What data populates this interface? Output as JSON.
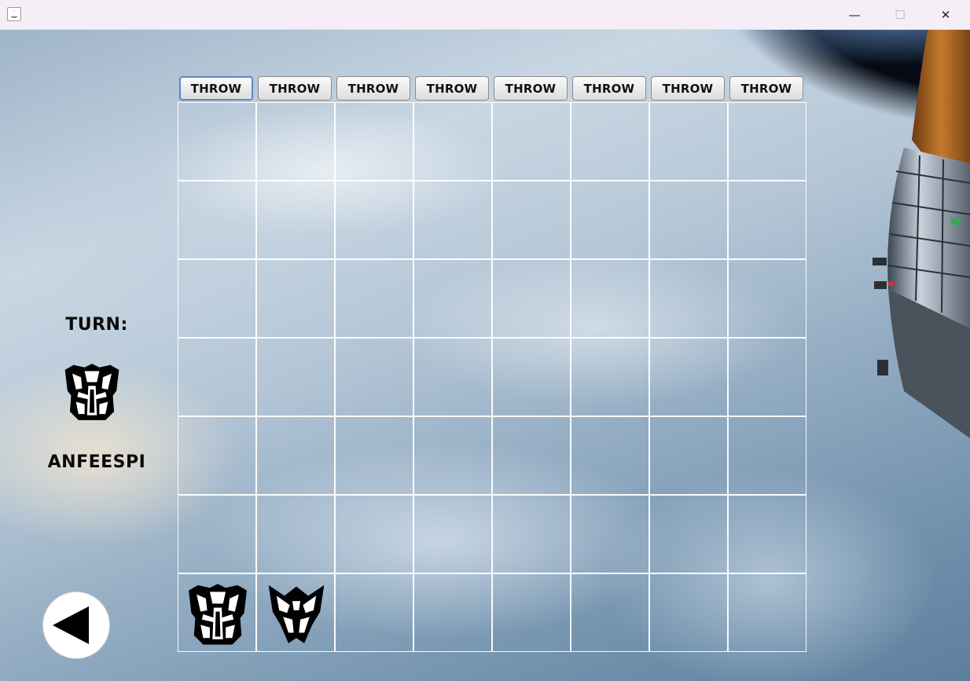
{
  "window": {
    "minimize_glyph": "—",
    "maximize_glyph": "☐",
    "close_glyph": "✕"
  },
  "throw_buttons": [
    "THROW",
    "THROW",
    "THROW",
    "THROW",
    "THROW",
    "THROW",
    "THROW",
    "THROW"
  ],
  "board": {
    "columns": 8,
    "rows": 7,
    "pieces": [
      {
        "row": 6,
        "col": 0,
        "faction": "autobot"
      },
      {
        "row": 6,
        "col": 1,
        "faction": "decepticon"
      }
    ]
  },
  "turn": {
    "label": "TURN:",
    "current_faction": "autobot",
    "player_name": "ANFEESPI"
  },
  "icons": {
    "back": "back-arrow-icon",
    "app": "java-app-icon"
  },
  "colors": {
    "grid_line": "#ffffff",
    "piece": "#000000",
    "button_face": "#e8e8e8"
  }
}
